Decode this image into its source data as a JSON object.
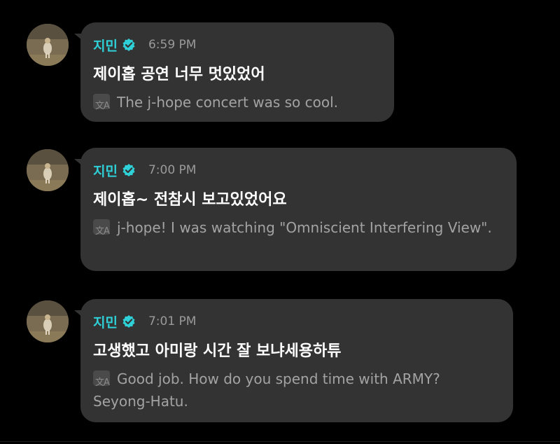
{
  "colors": {
    "background": "#000000",
    "bubble": "#333333",
    "name": "#2fd1d8",
    "verified_badge": "#2fd1d8",
    "time": "#9a9a9a",
    "message": "#ffffff",
    "translation": "#a3a3a3"
  },
  "icons": {
    "verified": "verified-badge-icon",
    "translate": "translate-icon",
    "avatar": "user-avatar"
  },
  "messages": [
    {
      "name": "지민",
      "time": "6:59 PM",
      "text": "제이홉 공연 너무 멋있었어",
      "translation": "The j-hope concert was so cool."
    },
    {
      "name": "지민",
      "time": "7:00 PM",
      "text": "제이홉~ 전참시 보고있었어요",
      "translation": "j-hope! I was watching \"Omniscient Interfering View\"."
    },
    {
      "name": "지민",
      "time": "7:01 PM",
      "text": "고생했고 아미랑 시간 잘 보냐세용하튜",
      "translation": "Good job. How do you spend time with ARMY? Seyong-Hatu."
    }
  ]
}
